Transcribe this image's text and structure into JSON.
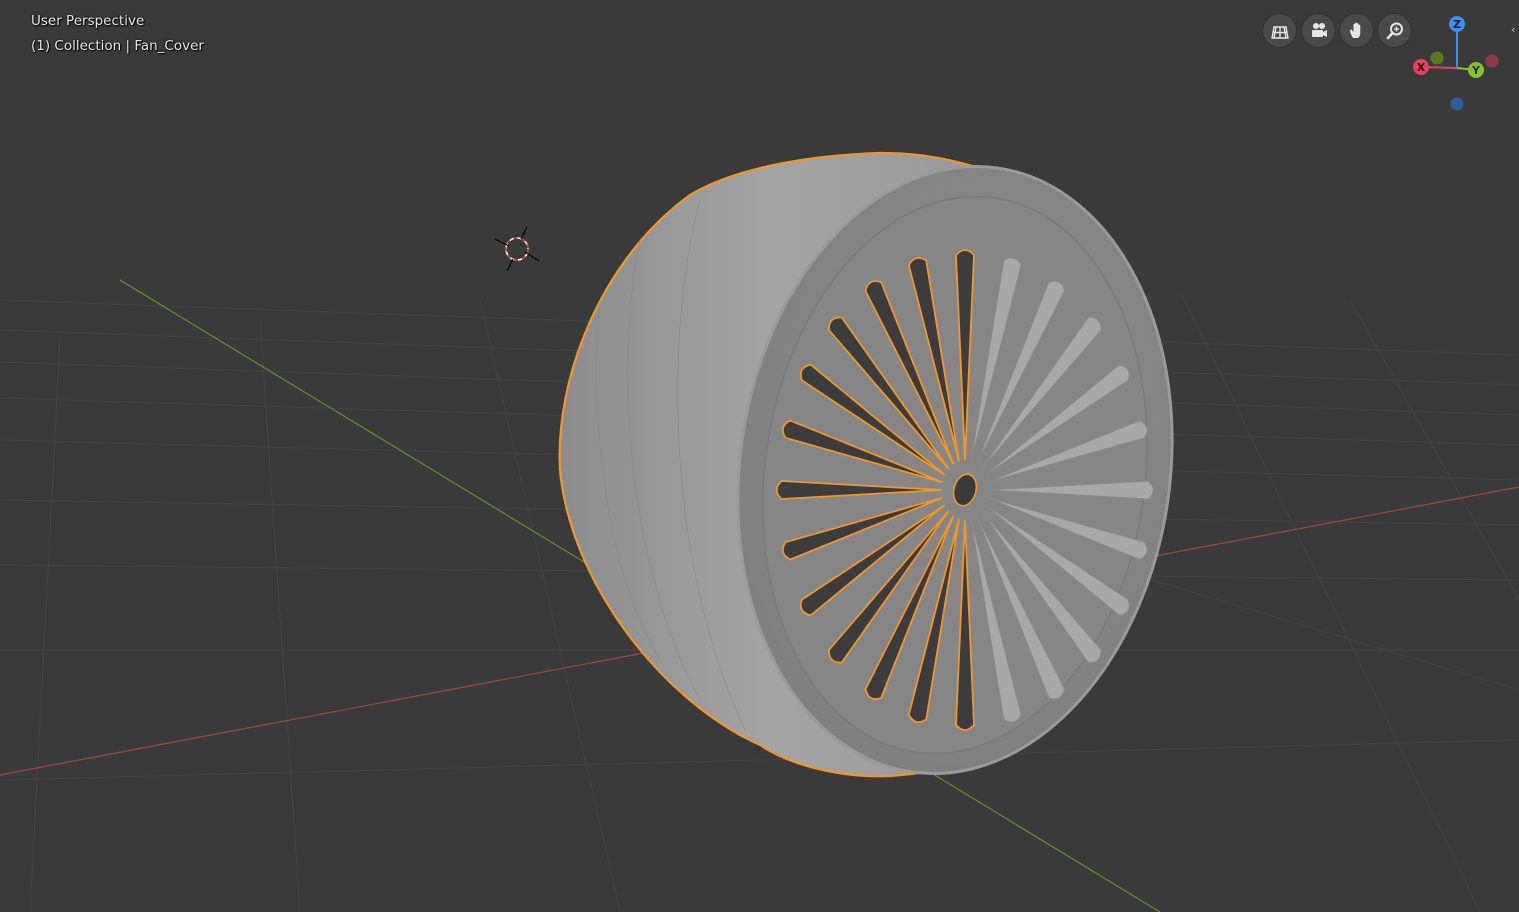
{
  "viewport": {
    "view_name": "User Perspective",
    "view_info": "(1) Collection | Fan_Cover",
    "colors": {
      "background": "#3a3a3a",
      "grid": "#444444",
      "x_axis": "#a04650",
      "y_axis": "#6f8a2e",
      "selection_outline": "#f0962a",
      "mesh": "#8e8e8e"
    }
  },
  "navigation": {
    "buttons": [
      {
        "name": "toggle-perspective-button",
        "icon": "grid-icon"
      },
      {
        "name": "camera-view-button",
        "icon": "camera-icon"
      },
      {
        "name": "pan-view-button",
        "icon": "hand-icon"
      },
      {
        "name": "zoom-view-button",
        "icon": "zoom-icon"
      }
    ]
  },
  "gizmo": {
    "z_label": "Z",
    "y_label": "Y",
    "x_label": "X",
    "colors": {
      "x": "#e8415d",
      "y": "#86c22d",
      "z": "#3d8ff0",
      "neg_x": "#8b3a46",
      "neg_y": "#5c7a22",
      "neg_z": "#2f5d9a"
    }
  },
  "sidebar_toggle": {
    "glyph": "‹"
  }
}
